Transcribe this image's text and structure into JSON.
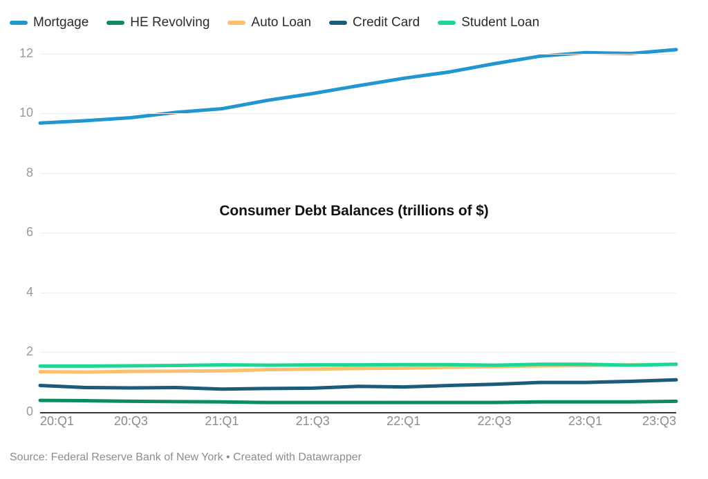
{
  "chart_data": {
    "type": "line",
    "title": "Consumer Debt Balances (trillions of $)",
    "xlabel": "",
    "ylabel": "",
    "ylim": [
      0,
      12.6
    ],
    "yticks": [
      "0",
      "2",
      "4",
      "6",
      "8",
      "10",
      "12"
    ],
    "grid": "horizontal",
    "legend_position": "top",
    "source_note": "Source: Federal Reserve Bank of New York • Created with Datawrapper",
    "categories": [
      "20:Q1",
      "20:Q2",
      "20:Q3",
      "20:Q4",
      "21:Q1",
      "21:Q2",
      "21:Q3",
      "21:Q4",
      "22:Q1",
      "22:Q2",
      "22:Q3",
      "22:Q4",
      "23:Q1",
      "23:Q2",
      "23:Q3"
    ],
    "xtick_labels": [
      "20:Q1",
      "20:Q3",
      "21:Q1",
      "21:Q3",
      "22:Q1",
      "22:Q3",
      "23:Q1",
      "23:Q3"
    ],
    "series": [
      {
        "name": "Mortgage",
        "color": "#2196cf",
        "values": [
          9.68,
          9.76,
          9.86,
          10.04,
          10.16,
          10.44,
          10.67,
          10.93,
          11.18,
          11.39,
          11.67,
          11.92,
          12.04,
          12.01,
          12.14
        ]
      },
      {
        "name": "HE Revolving",
        "color": "#0f8a66",
        "values": [
          0.39,
          0.38,
          0.36,
          0.35,
          0.34,
          0.32,
          0.32,
          0.32,
          0.32,
          0.32,
          0.32,
          0.34,
          0.34,
          0.34,
          0.36
        ]
      },
      {
        "name": "Auto Loan",
        "color": "#f9c06e",
        "values": [
          1.35,
          1.34,
          1.36,
          1.37,
          1.38,
          1.42,
          1.44,
          1.46,
          1.47,
          1.5,
          1.52,
          1.55,
          1.56,
          1.58,
          1.6
        ]
      },
      {
        "name": "Credit Card",
        "color": "#1d5b7b",
        "values": [
          0.89,
          0.82,
          0.81,
          0.82,
          0.77,
          0.79,
          0.8,
          0.86,
          0.84,
          0.89,
          0.93,
          0.99,
          0.99,
          1.03,
          1.08
        ]
      },
      {
        "name": "Student Loan",
        "color": "#1ed694",
        "values": [
          1.54,
          1.54,
          1.55,
          1.56,
          1.58,
          1.57,
          1.58,
          1.58,
          1.59,
          1.59,
          1.57,
          1.6,
          1.6,
          1.57,
          1.6
        ]
      }
    ]
  },
  "legend": {
    "items": [
      {
        "label": "Mortgage",
        "color": "#2196cf"
      },
      {
        "label": "HE Revolving",
        "color": "#0f8a66"
      },
      {
        "label": "Auto Loan",
        "color": "#f9c06e"
      },
      {
        "label": "Credit Card",
        "color": "#1d5b7b"
      },
      {
        "label": "Student Loan",
        "color": "#1ed694"
      }
    ]
  },
  "footer": {
    "text": "Source: Federal Reserve Bank of New York • Created with Datawrapper"
  }
}
